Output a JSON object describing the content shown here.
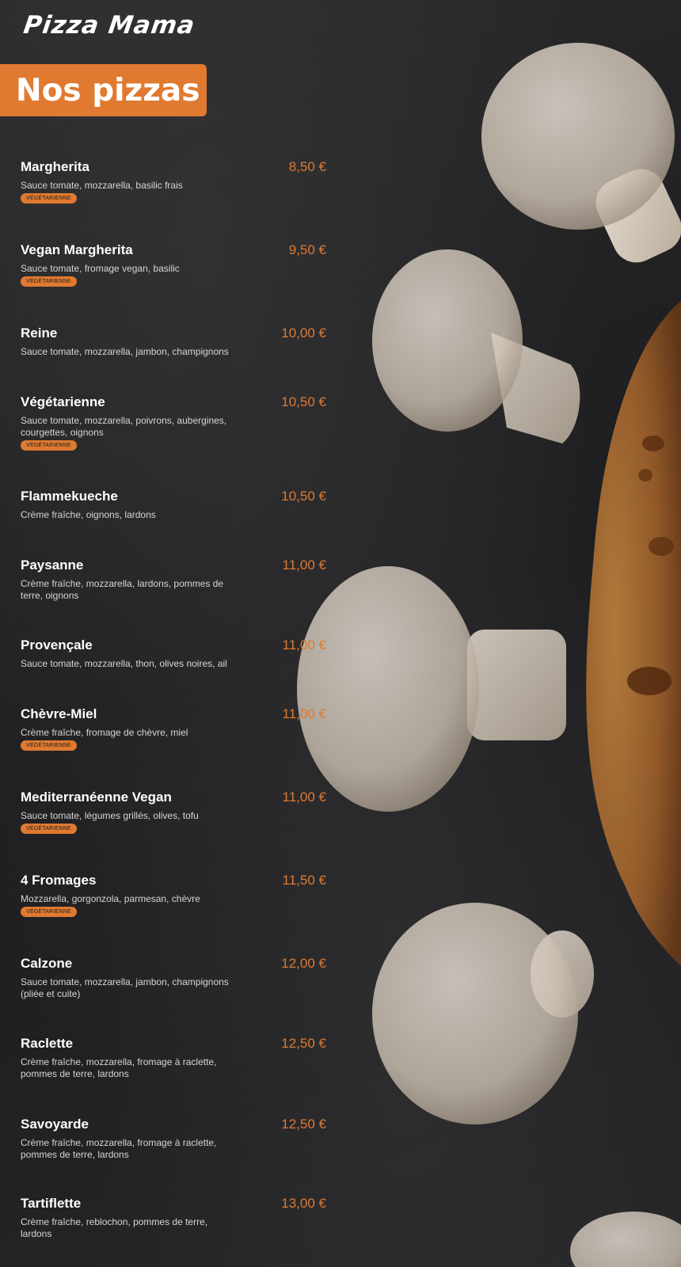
{
  "brand": {
    "logo_text": "Pizza Mama"
  },
  "section": {
    "title": "Nos pizzas"
  },
  "colors": {
    "accent": "#e07a30",
    "background": "#232325",
    "text": "#ffffff",
    "description": "#d6d6d6"
  },
  "pizzas": [
    {
      "name": "Margherita",
      "price": "8,50 €",
      "description": "Sauce tomate, mozzarella, basilic frais",
      "badge": "VÉGÉTARIENNE"
    },
    {
      "name": "Vegan Margherita",
      "price": "9,50 €",
      "description": "Sauce tomate, fromage vegan, basilic",
      "badge": "VÉGÉTARIENNE"
    },
    {
      "name": "Reine",
      "price": "10,00 €",
      "description": "Sauce tomate, mozzarella, jambon, champignons"
    },
    {
      "name": "Végétarienne",
      "price": "10,50 €",
      "description": "Sauce tomate, mozzarella, poivrons, aubergines, courgettes, oignons",
      "badge": "VÉGÉTARIENNE"
    },
    {
      "name": "Flammekueche",
      "price": "10,50 €",
      "description": "Crème fraîche, oignons, lardons"
    },
    {
      "name": "Paysanne",
      "price": "11,00 €",
      "description": "Crème fraîche, mozzarella, lardons, pommes de terre, oignons"
    },
    {
      "name": "Provençale",
      "price": "11,00 €",
      "description": "Sauce tomate, mozzarella, thon, olives noires, ail"
    },
    {
      "name": "Chèvre-Miel",
      "price": "11,00 €",
      "description": "Crème fraîche, fromage de chèvre, miel",
      "badge": "VÉGÉTARIENNE"
    },
    {
      "name": "Mediterranéenne Vegan",
      "price": "11,00 €",
      "description": "Sauce tomate, légumes grillés, olives, tofu",
      "badge": "VÉGÉTARIENNE"
    },
    {
      "name": "4 Fromages",
      "price": "11,50 €",
      "description": "Mozzarella, gorgonzola, parmesan, chèvre",
      "badge": "VÉGÉTARIENNE"
    },
    {
      "name": "Calzone",
      "price": "12,00 €",
      "description": "Sauce tomate, mozzarella, jambon, champignons (pliée et cuite)"
    },
    {
      "name": "Raclette",
      "price": "12,50 €",
      "description": "Crème fraîche, mozzarella, fromage à raclette, pommes de terre, lardons"
    },
    {
      "name": "Savoyarde",
      "price": "12,50 €",
      "description": "Crème fraîche, mozzarella, fromage à raclette, pommes de terre, lardons"
    },
    {
      "name": "Tartiflette",
      "price": "13,00 €",
      "description": "Crème fraîche, reblochon, pommes de terre, lardons"
    }
  ]
}
